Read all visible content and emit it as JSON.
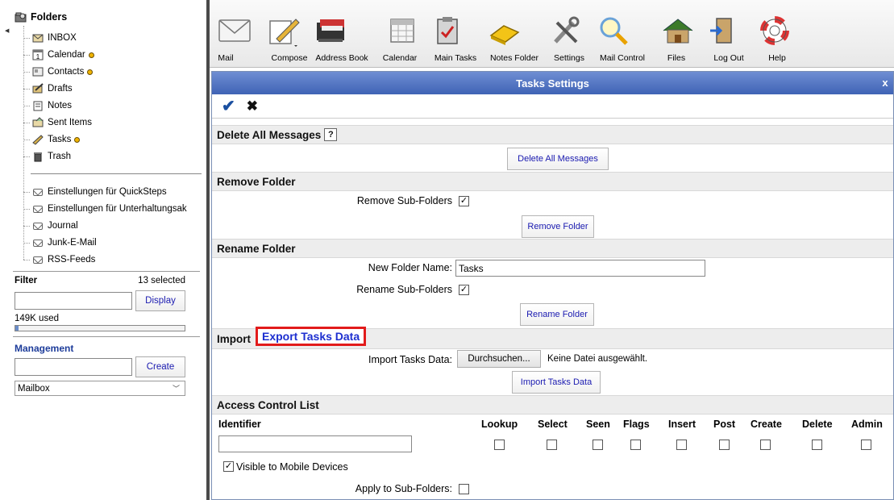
{
  "folders": {
    "root_label": "Folders",
    "items": [
      {
        "label": "INBOX",
        "icon": "inbox-icon",
        "dot": false
      },
      {
        "label": "Calendar",
        "icon": "calendar-icon",
        "dot": true
      },
      {
        "label": "Contacts",
        "icon": "contacts-icon",
        "dot": true
      },
      {
        "label": "Drafts",
        "icon": "drafts-icon",
        "dot": false
      },
      {
        "label": "Notes",
        "icon": "notes-icon",
        "dot": false
      },
      {
        "label": "Sent Items",
        "icon": "sent-items-icon",
        "dot": false
      },
      {
        "label": "Tasks",
        "icon": "tasks-icon",
        "dot": true
      },
      {
        "label": "Trash",
        "icon": "trash-icon",
        "dot": false
      }
    ],
    "extra_items": [
      "Einstellungen für QuickSteps",
      "Einstellungen für Unterhaltungsak",
      "Journal",
      "Junk-E-Mail",
      "RSS-Feeds"
    ]
  },
  "filter": {
    "title": "Filter",
    "count": "13 selected",
    "display_button": "Display",
    "used": "149K used",
    "used_fraction": 0.02
  },
  "management": {
    "title": "Management",
    "create_button": "Create",
    "selected": "Mailbox"
  },
  "toolbar": [
    {
      "label": "Mail",
      "icon": "mail-icon"
    },
    {
      "label": "Compose",
      "icon": "compose-icon"
    },
    {
      "label": "Address Book",
      "icon": "address-book-icon"
    },
    {
      "label": "Calendar",
      "icon": "calendar-icon"
    },
    {
      "label": "Main Tasks",
      "icon": "tasks-clipboard-icon"
    },
    {
      "label": "Notes Folder",
      "icon": "notes-folder-icon"
    },
    {
      "label": "Settings",
      "icon": "settings-tools-icon"
    },
    {
      "label": "Mail Control",
      "icon": "magnifier-icon"
    },
    {
      "label": "Files",
      "icon": "house-icon"
    },
    {
      "label": "Log Out",
      "icon": "logout-door-icon"
    },
    {
      "label": "Help",
      "icon": "lifebuoy-icon"
    }
  ],
  "dialog": {
    "title": "Tasks Settings",
    "close": "x",
    "ok": "✔",
    "cancel": "✖",
    "delete_all": {
      "heading": "Delete All Messages",
      "help": "?",
      "button": "Delete All Messages"
    },
    "remove_folder": {
      "heading": "Remove Folder",
      "sub_label": "Remove Sub-Folders",
      "sub_checked": true,
      "button": "Remove Folder"
    },
    "rename_folder": {
      "heading": "Rename Folder",
      "name_label": "New Folder Name:",
      "name_value": "Tasks",
      "sub_label": "Rename Sub-Folders",
      "sub_checked": true,
      "button": "Rename Folder"
    },
    "import": {
      "heading": "Import",
      "export_link": "Export Tasks Data",
      "file_label": "Import Tasks Data:",
      "browse_button": "Durchsuchen...",
      "no_file": "Keine Datei ausgewählt.",
      "button": "Import Tasks Data"
    },
    "acl": {
      "heading": "Access Control List",
      "identifier_label": "Identifier",
      "columns": [
        "Lookup",
        "Select",
        "Seen",
        "Flags",
        "Insert",
        "Post",
        "Create",
        "Delete",
        "Admin"
      ],
      "mobile_label": "Visible to Mobile Devices",
      "mobile_checked": true,
      "apply_label": "Apply to Sub-Folders:",
      "apply_checked": false
    }
  }
}
